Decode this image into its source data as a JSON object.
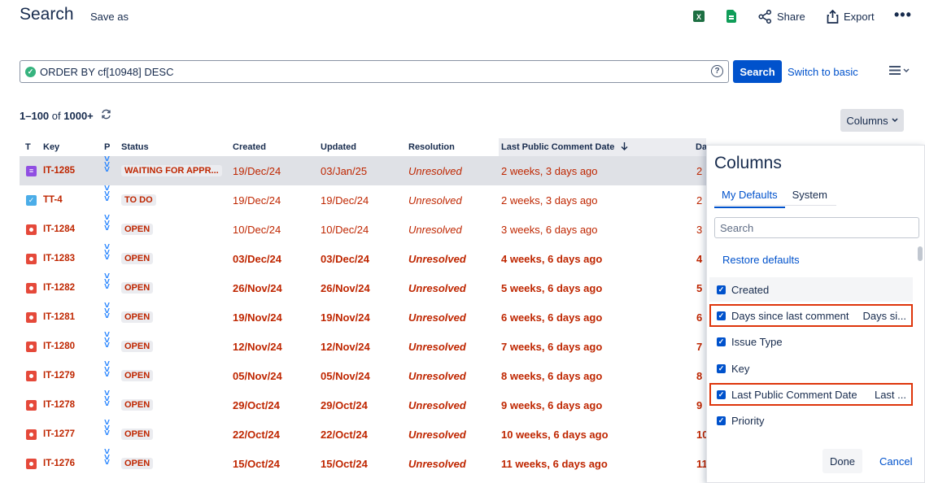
{
  "header": {
    "title": "Search",
    "save_as": "Save as",
    "share": "Share",
    "export": "Export",
    "more": "•••"
  },
  "jql": {
    "query": "ORDER BY cf[10948] DESC",
    "help": "?",
    "search_button": "Search",
    "switch_link": "Switch to basic"
  },
  "results": {
    "range": "1–100",
    "of": "of",
    "total": "1000+",
    "columns_button": "Columns"
  },
  "table": {
    "headers": {
      "t": "T",
      "key": "Key",
      "p": "P",
      "status": "Status",
      "created": "Created",
      "updated": "Updated",
      "resolution": "Resolution",
      "last_comment": "Last Public Comment Date",
      "days": "Da"
    },
    "rows": [
      {
        "type": "request",
        "key": "IT-1285",
        "status": "WAITING FOR APPR...",
        "created": "19/Dec/24",
        "updated": "03/Jan/25",
        "resolution": "Unresolved",
        "last_comment": "2 weeks, 3 days ago",
        "days": "2",
        "bold": false,
        "selected": true
      },
      {
        "type": "task",
        "key": "TT-4",
        "status": "TO DO",
        "created": "19/Dec/24",
        "updated": "19/Dec/24",
        "resolution": "Unresolved",
        "last_comment": "2 weeks, 3 days ago",
        "days": "2",
        "bold": false,
        "selected": false
      },
      {
        "type": "bug",
        "key": "IT-1284",
        "status": "OPEN",
        "created": "10/Dec/24",
        "updated": "10/Dec/24",
        "resolution": "Unresolved",
        "last_comment": "3 weeks, 6 days ago",
        "days": "3",
        "bold": false,
        "selected": false
      },
      {
        "type": "bug",
        "key": "IT-1283",
        "status": "OPEN",
        "created": "03/Dec/24",
        "updated": "03/Dec/24",
        "resolution": "Unresolved",
        "last_comment": "4 weeks, 6 days ago",
        "days": "4",
        "bold": true,
        "selected": false
      },
      {
        "type": "bug",
        "key": "IT-1282",
        "status": "OPEN",
        "created": "26/Nov/24",
        "updated": "26/Nov/24",
        "resolution": "Unresolved",
        "last_comment": "5 weeks, 6 days ago",
        "days": "5",
        "bold": true,
        "selected": false
      },
      {
        "type": "bug",
        "key": "IT-1281",
        "status": "OPEN",
        "created": "19/Nov/24",
        "updated": "19/Nov/24",
        "resolution": "Unresolved",
        "last_comment": "6 weeks, 6 days ago",
        "days": "6",
        "bold": true,
        "selected": false
      },
      {
        "type": "bug",
        "key": "IT-1280",
        "status": "OPEN",
        "created": "12/Nov/24",
        "updated": "12/Nov/24",
        "resolution": "Unresolved",
        "last_comment": "7 weeks, 6 days ago",
        "days": "7",
        "bold": true,
        "selected": false
      },
      {
        "type": "bug",
        "key": "IT-1279",
        "status": "OPEN",
        "created": "05/Nov/24",
        "updated": "05/Nov/24",
        "resolution": "Unresolved",
        "last_comment": "8 weeks, 6 days ago",
        "days": "8",
        "bold": true,
        "selected": false
      },
      {
        "type": "bug",
        "key": "IT-1278",
        "status": "OPEN",
        "created": "29/Oct/24",
        "updated": "29/Oct/24",
        "resolution": "Unresolved",
        "last_comment": "9 weeks, 6 days ago",
        "days": "9",
        "bold": true,
        "selected": false
      },
      {
        "type": "bug",
        "key": "IT-1277",
        "status": "OPEN",
        "created": "22/Oct/24",
        "updated": "22/Oct/24",
        "resolution": "Unresolved",
        "last_comment": "10 weeks, 6 days ago",
        "days": "10",
        "bold": true,
        "selected": false
      },
      {
        "type": "bug",
        "key": "IT-1276",
        "status": "OPEN",
        "created": "15/Oct/24",
        "updated": "15/Oct/24",
        "resolution": "Unresolved",
        "last_comment": "11 weeks, 6 days ago",
        "days": "11",
        "bold": true,
        "selected": false
      }
    ]
  },
  "columns_panel": {
    "title": "Columns",
    "tabs": [
      "My Defaults",
      "System"
    ],
    "search_placeholder": "Search",
    "restore": "Restore defaults",
    "options": [
      {
        "label": "Created",
        "extra": "",
        "checked": true
      },
      {
        "label": "Days since last comment",
        "extra": "Days si...",
        "checked": true
      },
      {
        "label": "Issue Type",
        "extra": "",
        "checked": true
      },
      {
        "label": "Key",
        "extra": "",
        "checked": true
      },
      {
        "label": "Last Public Comment Date",
        "extra": "Last ...",
        "checked": true
      },
      {
        "label": "Priority",
        "extra": "",
        "checked": true
      }
    ],
    "done": "Done",
    "cancel": "Cancel"
  },
  "colors": {
    "primary": "#0052cc",
    "issue_red": "#bf2600",
    "bug": "#e5493a",
    "task": "#4bade8",
    "request": "#904ee2",
    "highlight_outline": "#de350b",
    "excel_green": "#1d6f42",
    "sheets_green": "#0f9d58"
  },
  "icons": {
    "excel": "excel-icon",
    "sheets": "google-sheets-icon",
    "share": "share-icon",
    "export": "export-icon",
    "check": "check-circle-icon",
    "help": "help-icon",
    "list_menu": "list-menu-icon",
    "refresh": "refresh-icon",
    "sort": "arrow-down-icon",
    "search": "search-icon",
    "priority": "priority-lowest-icon"
  }
}
